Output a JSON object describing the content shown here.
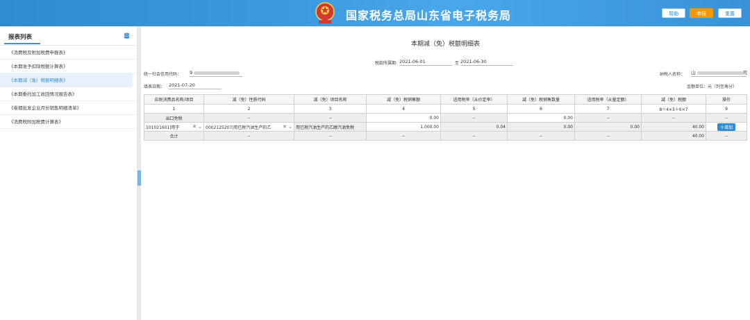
{
  "header": {
    "title": "国家税务总局山东省电子税务局",
    "buttons": {
      "help": "帮助",
      "declare": "申报",
      "reset": "重置"
    }
  },
  "sidebar": {
    "title": "报表列表",
    "items": [
      "《消费税及附加税费申报表》",
      "《本期准予扣除税额计算表》",
      "《本期减（免）税额明细表》",
      "《本期委托加工收回情况报告表》",
      "《卷烟批发企业月份销售明细清单》",
      "《消费税附加税费计算表》"
    ],
    "active_index": 2
  },
  "form": {
    "title": "本期减（免）税额明细表",
    "period_label": "税款所属期:",
    "period_start": "2021-06-01",
    "period_to": "至",
    "period_end": "2021-06-30",
    "credit_code_label": "统一社会信用代码：",
    "credit_code_value": "9",
    "taxpayer_label": "纳税人名称：",
    "taxpayer_value": "山",
    "taxpayer_suffix": "司",
    "fill_date_label": "填表日期：",
    "fill_date": "2021-07-20",
    "unit": "金额单位：元（列至角分）"
  },
  "table": {
    "headers": [
      "应税消费品名称/项目",
      "减（免）性质代码",
      "减（免）项目名称",
      "减（免）税销售额",
      "适用税率（从价定率）",
      "减（免）税销售数量",
      "适用税率（从量定额）",
      "减（免）税额",
      "操作"
    ],
    "index_row": [
      "1",
      "2",
      "3",
      "4",
      "5",
      "6",
      "7",
      "8＝4×5＋6×7",
      "9"
    ],
    "export_row": [
      "出口免税",
      "--",
      "--",
      "0.00",
      "--",
      "0.00",
      "--",
      "--",
      "--"
    ],
    "data_row": {
      "product": "101021601|用于",
      "code": "0002125207|用已税汽油生产的乙",
      "name": "用已税汽油生产的乙醇汽油免税",
      "sales": "1,000.00",
      "rate": "0.04",
      "qty": "0.00",
      "unit_rate": "0.00",
      "tax": "40.00",
      "action": "十增加"
    },
    "total_row": [
      "合计",
      "--",
      "--",
      "--",
      "--",
      "--",
      "--",
      "40.00",
      "--"
    ]
  }
}
